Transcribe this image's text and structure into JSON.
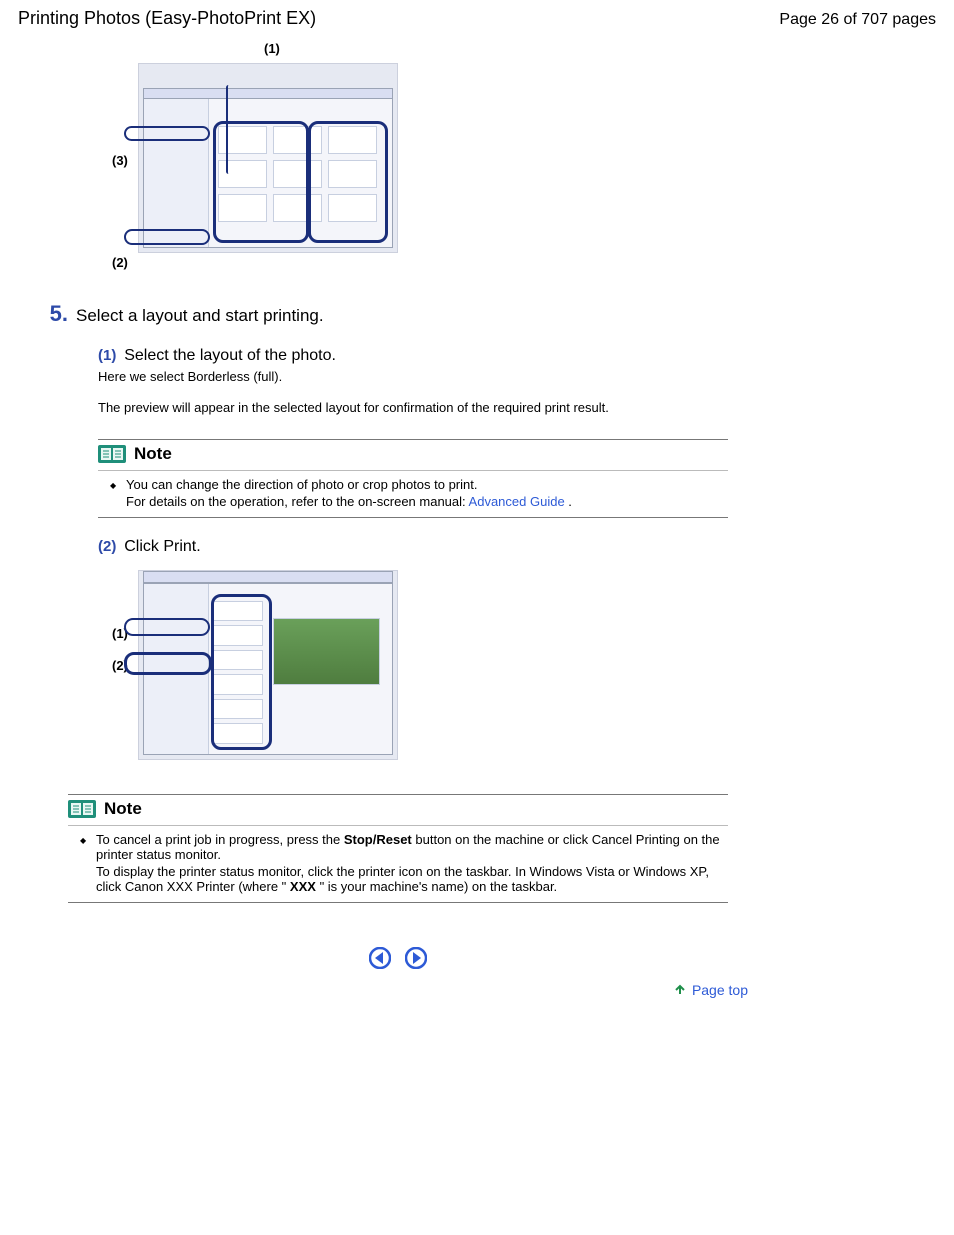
{
  "header": {
    "title": "Printing Photos (Easy-PhotoPrint EX)",
    "page_label": "Page 26 of 707 pages"
  },
  "figure1": {
    "label_1": "(1)",
    "label_2": "(2)",
    "label_3": "(3)"
  },
  "step5": {
    "number": "5.",
    "title": "Select a layout and start printing."
  },
  "sub1": {
    "number": "(1)",
    "title": "Select the layout of the photo.",
    "desc": "Here we select Borderless (full).",
    "preview": "The preview will appear in the selected layout for confirmation of the required print result."
  },
  "note1": {
    "label": "Note",
    "line1": "You can change the direction of photo or crop photos to print.",
    "line2_pre": "For details on the operation, refer to the on-screen manual: ",
    "link": "Advanced Guide",
    "line2_post": "."
  },
  "sub2": {
    "number": "(2)",
    "title": "Click Print."
  },
  "figure2": {
    "label_1": "(1)",
    "label_2": "(2)"
  },
  "note2": {
    "label": "Note",
    "line1_pre": "To cancel a print job in progress, press the ",
    "bold1": "Stop/Reset",
    "line1_post": " button on the machine or click Cancel Printing on the printer status monitor.",
    "line2_pre": "To display the printer status monitor, click the printer icon on the taskbar. In Windows Vista or Windows XP, click Canon XXX Printer (where \"",
    "bold2": "XXX",
    "line2_post": "\" is your machine's name) on the taskbar."
  },
  "page_top": "Page top"
}
